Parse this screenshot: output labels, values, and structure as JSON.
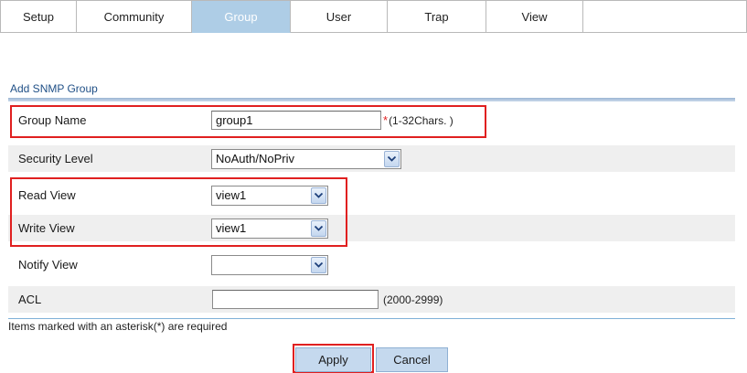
{
  "tabs": [
    {
      "label": "Setup",
      "active": false
    },
    {
      "label": "Community",
      "active": false
    },
    {
      "label": "Group",
      "active": true
    },
    {
      "label": "User",
      "active": false
    },
    {
      "label": "Trap",
      "active": false
    },
    {
      "label": "View",
      "active": false
    }
  ],
  "section_title": "Add SNMP Group",
  "form": {
    "group_name": {
      "label": "Group Name",
      "value": "group1",
      "required_mark": "*",
      "hint": "(1-32Chars. )"
    },
    "security_level": {
      "label": "Security Level",
      "value": "NoAuth/NoPriv"
    },
    "read_view": {
      "label": "Read View",
      "value": "view1"
    },
    "write_view": {
      "label": "Write View",
      "value": "view1"
    },
    "notify_view": {
      "label": "Notify View",
      "value": ""
    },
    "acl": {
      "label": "ACL",
      "value": "",
      "hint": "(2000-2999)"
    }
  },
  "note": "Items marked with an asterisk(*) are required",
  "buttons": {
    "apply": "Apply",
    "cancel": "Cancel"
  },
  "colors": {
    "active_tab": "#aecde6",
    "highlight_box": "#e02020",
    "section_title": "#1f4f86",
    "button_bg": "#c5d9ee"
  },
  "icons": {
    "select_arrow": "chevron-down-icon"
  }
}
